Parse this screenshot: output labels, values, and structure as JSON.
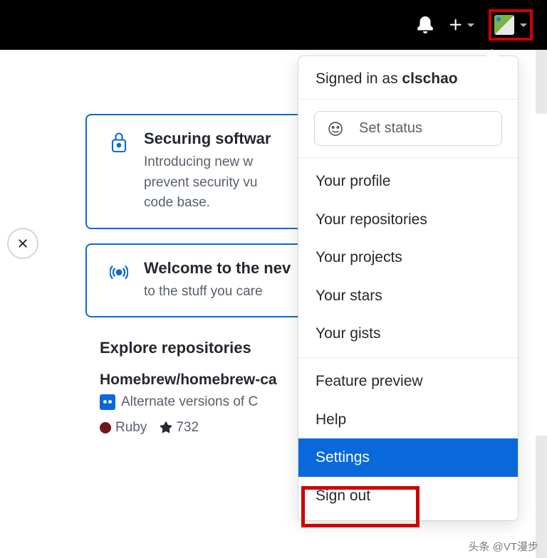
{
  "header": {
    "icons": {
      "notifications": "bell-icon",
      "create": "plus-icon",
      "avatar": "avatar"
    }
  },
  "cards": [
    {
      "title": "Securing softwar",
      "body": "Introducing new w\nprevent security vu\ncode base.",
      "icon": "lock-icon"
    },
    {
      "title": "Welcome to the nev",
      "body": "to the stuff you care",
      "icon": "broadcast-icon"
    }
  ],
  "explore": {
    "heading": "Explore repositories",
    "repo": {
      "name": "Homebrew/homebrew-ca",
      "desc": "Alternate versions of C",
      "lang": "Ruby",
      "stars": "732"
    }
  },
  "dropdown": {
    "signed_in_prefix": "Signed in as ",
    "username": "clschao",
    "status": "Set status",
    "groups": [
      [
        "Your profile",
        "Your repositories",
        "Your projects",
        "Your stars",
        "Your gists"
      ],
      [
        "Feature preview",
        "Help",
        "Settings",
        "Sign out"
      ]
    ],
    "active": "Settings"
  },
  "watermark": "头条 @VT漫步"
}
